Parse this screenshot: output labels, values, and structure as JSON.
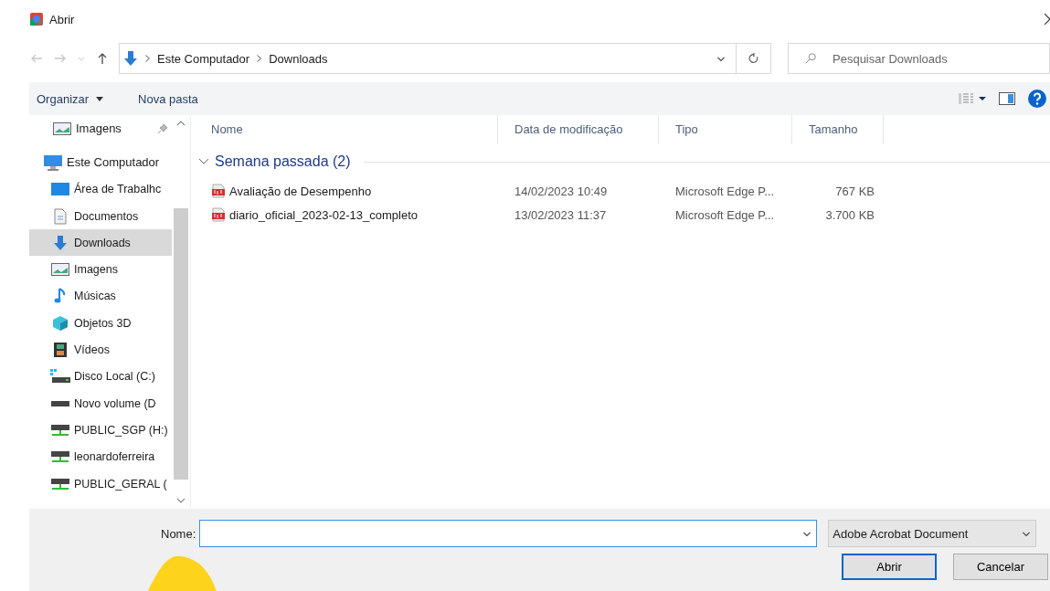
{
  "window": {
    "title": "Abrir"
  },
  "address": {
    "path": [
      "Este Computador",
      "Downloads"
    ]
  },
  "search": {
    "placeholder": "Pesquisar Downloads"
  },
  "toolbar": {
    "buttons": [
      "Organizar",
      "Nova pasta"
    ]
  },
  "sidebar": {
    "items": [
      {
        "label": "Imagens",
        "kind": "picture",
        "pinned": true,
        "selected": false
      },
      {
        "label": "Este Computador",
        "kind": "computer",
        "selected": false,
        "children": [
          {
            "label": "Área de Trabalhc",
            "kind": "desktop",
            "selected": false
          },
          {
            "label": "Documentos",
            "kind": "document",
            "selected": false
          },
          {
            "label": "Downloads",
            "kind": "download",
            "selected": true
          },
          {
            "label": "Imagens",
            "kind": "picture",
            "selected": false
          },
          {
            "label": "Músicas",
            "kind": "music",
            "selected": false
          },
          {
            "label": "Objetos 3D",
            "kind": "cube",
            "selected": false
          },
          {
            "label": "Vídeos",
            "kind": "video",
            "selected": false
          },
          {
            "label": "Disco Local (C:)",
            "kind": "system-drive",
            "selected": false
          },
          {
            "label": "Novo volume (D",
            "kind": "drive",
            "selected": false
          },
          {
            "label": "PUBLIC_SGP (H:)",
            "kind": "network-drive",
            "selected": false
          },
          {
            "label": "leonardoferreira",
            "kind": "network-drive",
            "selected": false
          },
          {
            "label": "PUBLIC_GERAL (",
            "kind": "network-drive",
            "selected": false
          }
        ]
      }
    ]
  },
  "table": {
    "columns": [
      "Nome",
      "Data de modificação",
      "Tipo",
      "Tamanho"
    ],
    "group": {
      "label": "Semana passada (2)",
      "expanded": true
    },
    "rows": [
      {
        "name": "Avaliação de Desempenho",
        "date": "14/02/2023 10:49",
        "type": "Microsoft Edge P...",
        "size": "767 KB"
      },
      {
        "name": "diario_oficial_2023-02-13_completo",
        "date": "13/02/2023 11:37",
        "type": "Microsoft Edge P...",
        "size": "3.700 KB"
      }
    ]
  },
  "footer": {
    "name_label": "Nome:",
    "filter": "Adobe Acrobat Document",
    "buttons": [
      "Abrir",
      "Cancelar"
    ]
  }
}
